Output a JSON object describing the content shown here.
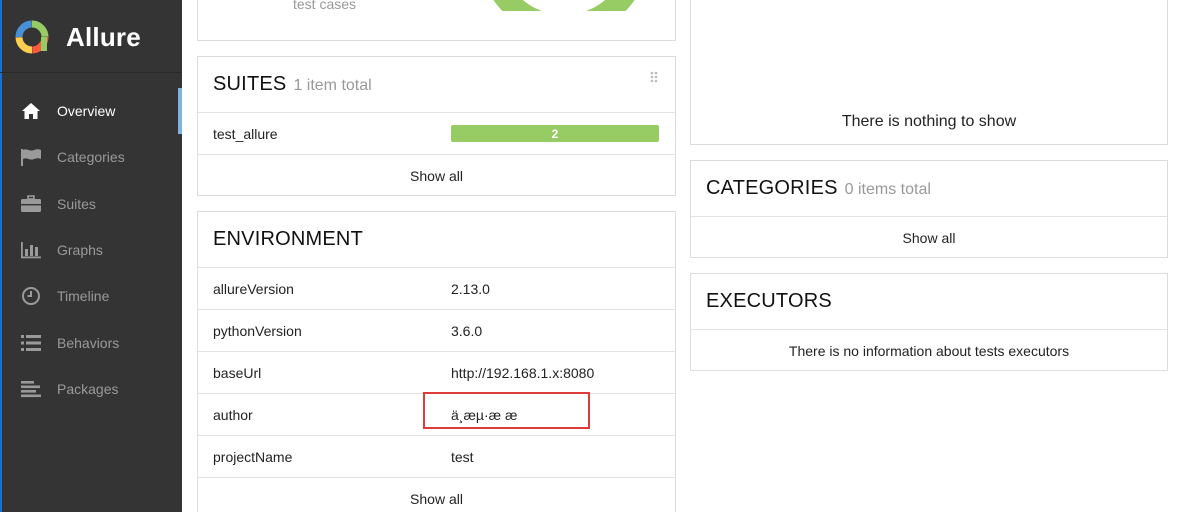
{
  "brand": {
    "name": "Allure"
  },
  "nav": [
    {
      "label": "Overview",
      "icon": "home-icon",
      "active": true
    },
    {
      "label": "Categories",
      "icon": "flag-icon",
      "active": false
    },
    {
      "label": "Suites",
      "icon": "briefcase-icon",
      "active": false
    },
    {
      "label": "Graphs",
      "icon": "bar-chart-icon",
      "active": false
    },
    {
      "label": "Timeline",
      "icon": "clock-icon",
      "active": false
    },
    {
      "label": "Behaviors",
      "icon": "list-icon",
      "active": false
    },
    {
      "label": "Packages",
      "icon": "align-left-icon",
      "active": false
    }
  ],
  "summary": {
    "caption": "test cases"
  },
  "suites": {
    "title": "SUITES",
    "count": "1 item total",
    "items": [
      {
        "name": "test_allure",
        "passed": "2",
        "passed_fraction": 1.0
      }
    ],
    "show_all": "Show all"
  },
  "environment": {
    "title": "ENVIRONMENT",
    "rows": [
      {
        "key": "allureVersion",
        "value": "2.13.0"
      },
      {
        "key": "pythonVersion",
        "value": "3.6.0"
      },
      {
        "key": "baseUrl",
        "value": "http://192.168.1.x:8080"
      },
      {
        "key": "author",
        "value": "ä¸æµ·æ æ"
      },
      {
        "key": "projectName",
        "value": "test"
      }
    ],
    "show_all": "Show all"
  },
  "trend": {
    "empty_text": "There is nothing to show"
  },
  "categories": {
    "title": "CATEGORIES",
    "count": "0 items total",
    "show_all": "Show all"
  },
  "executors": {
    "title": "EXECUTORS",
    "empty_text": "There is no information about tests executors"
  },
  "colors": {
    "sidebar": "#343434",
    "passed": "#97cc64",
    "highlight": "#e03b3b"
  }
}
